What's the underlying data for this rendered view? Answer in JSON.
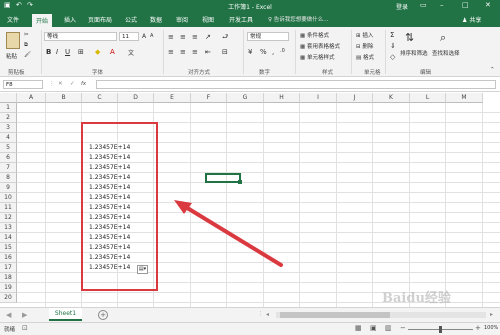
{
  "window": {
    "title": "工作簿1 - Excel",
    "login": "登录"
  },
  "tabs": [
    "文件",
    "开始",
    "插入",
    "页面布局",
    "公式",
    "数据",
    "审阅",
    "视图",
    "开发工具"
  ],
  "search_placeholder": "告诉我您想要做什么...",
  "share": "共享",
  "ribbon": {
    "paste": "粘贴",
    "font_name": "等线",
    "font_size": "11",
    "number_format": "常规",
    "styles": [
      "条件格式",
      "套用表格格式",
      "单元格样式"
    ],
    "cells": [
      "插入",
      "删除",
      "格式"
    ],
    "sort_filter": "排序和筛选",
    "find_select": "查找和选择",
    "groups": [
      "剪贴板",
      "字体",
      "对齐方式",
      "数字",
      "样式",
      "单元格",
      "编辑"
    ]
  },
  "formula_bar": {
    "name_box": "F8",
    "fx": "fx",
    "value": ""
  },
  "columns": [
    "A",
    "B",
    "C",
    "D",
    "E",
    "F",
    "G",
    "H",
    "I",
    "J",
    "K",
    "L",
    "M"
  ],
  "rows": [
    "1",
    "2",
    "3",
    "4",
    "5",
    "6",
    "7",
    "8",
    "9",
    "10",
    "11",
    "12",
    "13",
    "14",
    "15",
    "16",
    "17",
    "18",
    "19",
    "20"
  ],
  "cells": [
    "1.23457E+14",
    "1.23457E+14",
    "1.23457E+14",
    "1.23457E+14",
    "1.23457E+14",
    "1.23457E+14",
    "1.23457E+14",
    "1.23457E+14",
    "1.23457E+14",
    "1.23457E+14",
    "1.23457E+14",
    "1.23457E+14",
    "1.23457E+14"
  ],
  "selected_cell": "F8",
  "sheet_tab": "Sheet1",
  "status": {
    "ready": "就绪",
    "zoom": "100%"
  },
  "watermark": "Baidu经验",
  "colors": {
    "brand": "#217346",
    "annotation": "#d9393f",
    "selection": "#217346"
  }
}
